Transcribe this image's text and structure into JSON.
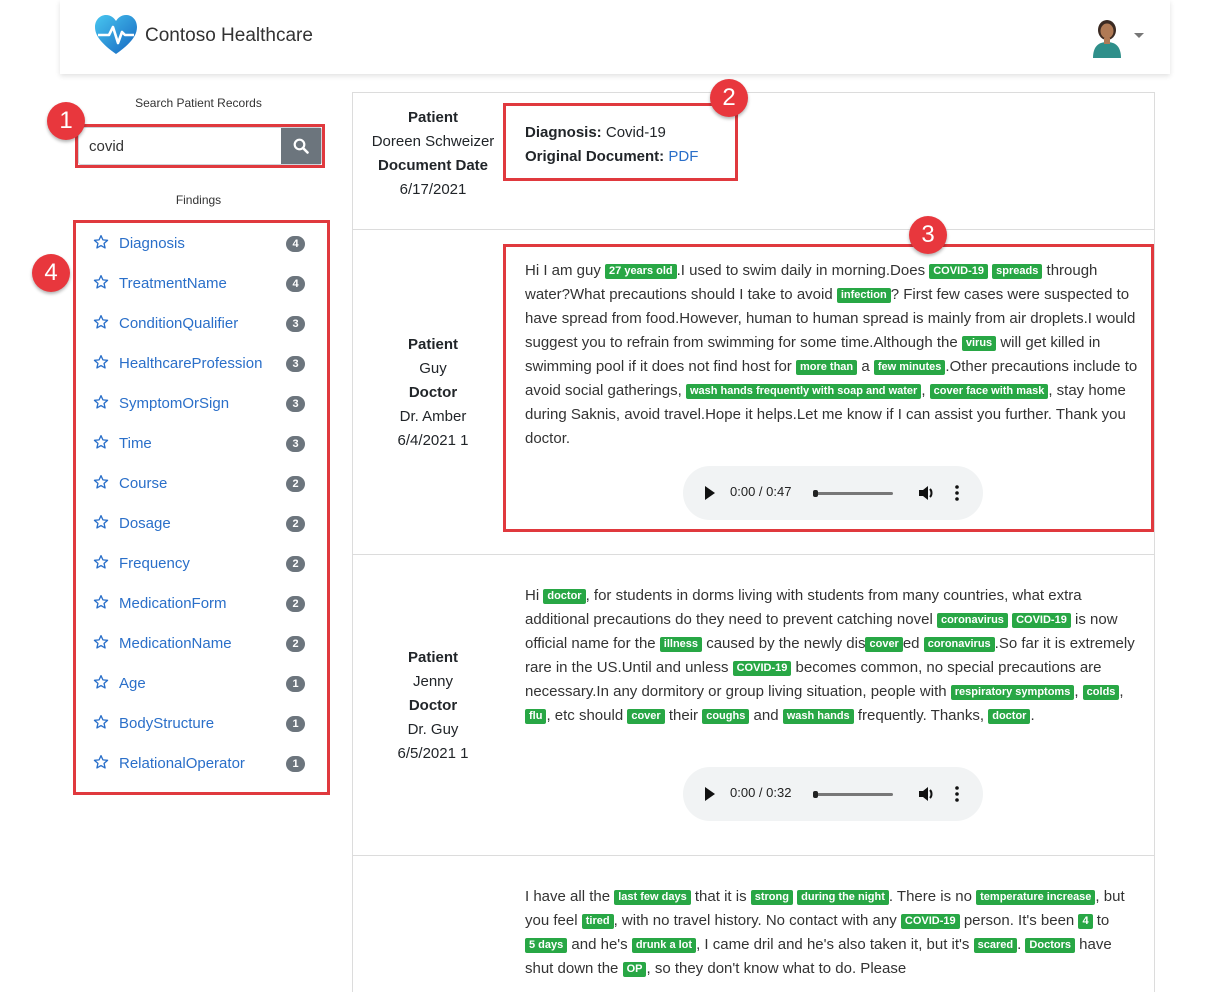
{
  "app": {
    "brand": "Contoso Healthcare",
    "accent_color": "#2a6fc9",
    "tag_color": "#28a745",
    "annotation_color": "#e0393e"
  },
  "search": {
    "title": "Search Patient Records",
    "value": "covid",
    "button_icon": "search-icon"
  },
  "findings": {
    "title": "Findings",
    "items": [
      {
        "label": "Diagnosis",
        "count": "4"
      },
      {
        "label": "TreatmentName",
        "count": "4"
      },
      {
        "label": "ConditionQualifier",
        "count": "3"
      },
      {
        "label": "HealthcareProfession",
        "count": "3"
      },
      {
        "label": "SymptomOrSign",
        "count": "3"
      },
      {
        "label": "Time",
        "count": "3"
      },
      {
        "label": "Course",
        "count": "2"
      },
      {
        "label": "Dosage",
        "count": "2"
      },
      {
        "label": "Frequency",
        "count": "2"
      },
      {
        "label": "MedicationForm",
        "count": "2"
      },
      {
        "label": "MedicationName",
        "count": "2"
      },
      {
        "label": "Age",
        "count": "1"
      },
      {
        "label": "BodyStructure",
        "count": "1"
      },
      {
        "label": "RelationalOperator",
        "count": "1"
      }
    ]
  },
  "annotations": [
    "1",
    "2",
    "3",
    "4"
  ],
  "document": {
    "patient_label": "Patient",
    "patient": "Doreen Schweizer",
    "date_label": "Document Date",
    "date": "6/17/2021",
    "diagnosis_label": "Diagnosis:",
    "diagnosis": "Covid-19",
    "original_label": "Original Document:",
    "original_link": "PDF"
  },
  "records": [
    {
      "patient_label": "Patient",
      "patient": "Guy",
      "doctor_label": "Doctor",
      "doctor": "Dr. Amber",
      "date": "6/4/2021 1",
      "audio_time": "0:00 / 0:47",
      "message": [
        {
          "t": "Hi I am guy "
        },
        {
          "tag": "27 years old"
        },
        {
          "t": ".I used to swim daily in morning.Does "
        },
        {
          "tag": "COVID-19"
        },
        {
          "t": " "
        },
        {
          "tag": "spreads"
        },
        {
          "t": " through water?What precautions should I take to avoid "
        },
        {
          "tag": "infection"
        },
        {
          "t": "? First few cases were suspected to have spread from food.However, human to human spread is mainly from air droplets.I would suggest you to refrain from swimming for some time.Although the "
        },
        {
          "tag": "virus"
        },
        {
          "t": " will get killed in swimming pool if it does not find host for "
        },
        {
          "tag": "more than"
        },
        {
          "t": " a "
        },
        {
          "tag": "few minutes"
        },
        {
          "t": ".Other precautions include to avoid social gatherings, "
        },
        {
          "tag": "wash hands frequently with soap and water"
        },
        {
          "t": ", "
        },
        {
          "tag": "cover face with mask"
        },
        {
          "t": ", stay home during Saknis, avoid travel.Hope it helps.Let me know if I can assist you further. Thank you doctor."
        }
      ]
    },
    {
      "patient_label": "Patient",
      "patient": "Jenny",
      "doctor_label": "Doctor",
      "doctor": "Dr. Guy",
      "date": "6/5/2021 1",
      "audio_time": "0:00 / 0:32",
      "message": [
        {
          "t": "Hi "
        },
        {
          "tag": "doctor"
        },
        {
          "t": ", for students in dorms living with students from many countries, what extra additional precautions do they need to prevent catching novel "
        },
        {
          "tag": "coronavirus"
        },
        {
          "t": " "
        },
        {
          "tag": "COVID-19"
        },
        {
          "t": " is now official name for the "
        },
        {
          "tag": "illness"
        },
        {
          "t": " caused by the newly dis"
        },
        {
          "tag": "cover"
        },
        {
          "t": "ed "
        },
        {
          "tag": "coronavirus"
        },
        {
          "t": ".So far it is extremely rare in the US.Until and unless "
        },
        {
          "tag": "COVID-19"
        },
        {
          "t": " becomes common, no special precautions are necessary.In any dormitory or group living situation, people with "
        },
        {
          "tag": "respiratory symptoms"
        },
        {
          "t": ", "
        },
        {
          "tag": "colds"
        },
        {
          "t": ", "
        },
        {
          "tag": "flu"
        },
        {
          "t": ", etc should "
        },
        {
          "tag": "cover"
        },
        {
          "t": " their "
        },
        {
          "tag": "coughs"
        },
        {
          "t": " and "
        },
        {
          "tag": "wash hands"
        },
        {
          "t": " frequently. Thanks, "
        },
        {
          "tag": "doctor"
        },
        {
          "t": "."
        }
      ]
    },
    {
      "message": [
        {
          "t": "I have all the "
        },
        {
          "tag": "last few days"
        },
        {
          "t": " that it is "
        },
        {
          "tag": "strong"
        },
        {
          "t": " "
        },
        {
          "tag": "during the night"
        },
        {
          "t": ". There is no "
        },
        {
          "tag": "temperature increase"
        },
        {
          "t": ", but you feel "
        },
        {
          "tag": "tired"
        },
        {
          "t": ", with no travel history. No contact with any "
        },
        {
          "tag": "COVID-19"
        },
        {
          "t": " person. It's been "
        },
        {
          "tag": "4"
        },
        {
          "t": " to "
        },
        {
          "tag": "5 days"
        },
        {
          "t": " and he's "
        },
        {
          "tag": "drunk a lot"
        },
        {
          "t": ", I came dril and he's also taken it, but it's "
        },
        {
          "tag": "scared"
        },
        {
          "t": ". "
        },
        {
          "tag": "Doctors"
        },
        {
          "t": " have shut down the "
        },
        {
          "tag": "OP"
        },
        {
          "t": ", so they don't know what to do. Please"
        }
      ]
    }
  ]
}
